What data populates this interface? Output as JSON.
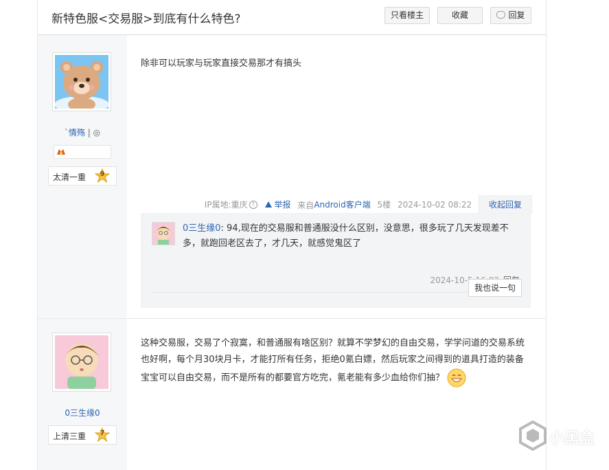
{
  "header": {
    "title": "新特色服<交易服>到底有什么特色?",
    "only_op_label": "只看楼主",
    "favorite_label": "收藏",
    "reply_label": "回复"
  },
  "posts": [
    {
      "username": "`情殇",
      "username_suffix": "|",
      "level_name": "太清一重",
      "level": "9",
      "content": "除非可以玩家与玩家直接交易那才有搞头",
      "meta": {
        "ip_location": "IP属地:重庆",
        "report_label": "举报",
        "from_label": "来自",
        "client": "Android客户端",
        "floor": "5楼",
        "time": "2024-10-02 08:22",
        "collapse_label": "收起回复"
      },
      "sub_reply": {
        "user": "0三生缘0",
        "text": ": 94,现在的交易服和普通服没什么区别，没意思，很多玩了几天发现差不多，就跑回老区去了，才几天，就感觉鬼区了",
        "time": "2024-10-5 16:02",
        "reply_label": "回复"
      },
      "say_label": "我也说一句"
    },
    {
      "username": "0三生缘0",
      "level_name": "上清三重",
      "level": "7",
      "content": "这种交易服，交易了个寂寞，和普通服有啥区别？就算不学梦幻的自由交易，学学问道的交易系统也好啊，每个月30块月卡，才能打所有任务，拒绝0氪白嫖，然后玩家之间得到的道具打造的装备宝宝可以自由交易，而不是所有的都要官方吃完，氪老能有多少血给你们抽？"
    }
  ],
  "watermark": "小黑盒",
  "colors": {
    "link": "#2d64b3",
    "sidebar_bg": "#f6f7f9",
    "sub_reply_bg": "#f3f4f6"
  }
}
